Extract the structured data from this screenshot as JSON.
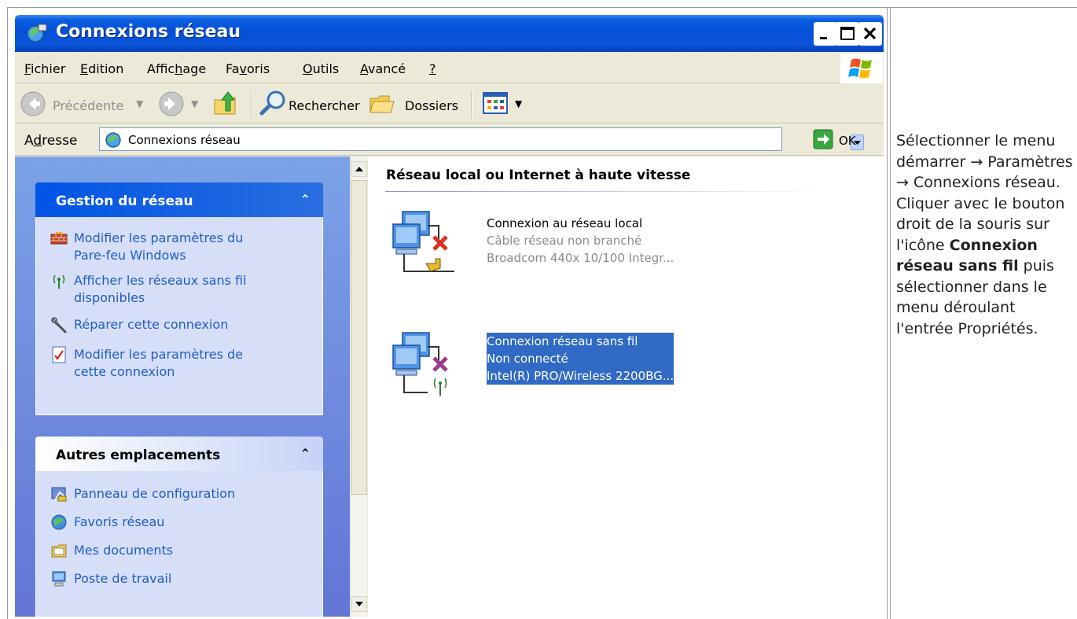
{
  "window": {
    "title": "Connexions réseau"
  },
  "menubar": {
    "items": [
      {
        "pre": "",
        "key": "F",
        "post": "ichier"
      },
      {
        "pre": "",
        "key": "E",
        "post": "dition"
      },
      {
        "pre": "Affic",
        "key": "h",
        "post": "age"
      },
      {
        "pre": "Fa",
        "key": "v",
        "post": "oris"
      },
      {
        "pre": "",
        "key": "O",
        "post": "utils"
      },
      {
        "pre": "",
        "key": "A",
        "post": "vancé"
      },
      {
        "pre": "",
        "key": "?",
        "post": ""
      }
    ]
  },
  "toolbar": {
    "back_label": "Précédente",
    "search_label": "Rechercher",
    "folders_label": "Dossiers"
  },
  "address": {
    "label_pre": "A",
    "label_key": "d",
    "label_post": "resse",
    "value": "Connexions réseau",
    "go_label": "OK"
  },
  "taskpane": {
    "network_tasks": {
      "title": "Gestion du réseau",
      "items": [
        {
          "line1": "Modifier les paramètres du",
          "line2": "Pare-feu Windows",
          "icon": "firewall-icon"
        },
        {
          "line1": "Afficher les réseaux sans fil",
          "line2": "disponibles",
          "icon": "wireless-icon"
        },
        {
          "line1": "Réparer cette connexion",
          "line2": "",
          "icon": "repair-icon"
        },
        {
          "line1": "Modifier les paramètres de",
          "line2": "cette connexion",
          "icon": "properties-icon"
        }
      ]
    },
    "other_places": {
      "title": "Autres emplacements",
      "items": [
        {
          "label": "Panneau de configuration",
          "icon": "control-panel-icon"
        },
        {
          "label": "Favoris réseau",
          "icon": "network-places-icon"
        },
        {
          "label": "Mes documents",
          "icon": "my-documents-icon"
        },
        {
          "label": "Poste de travail",
          "icon": "my-computer-icon"
        }
      ]
    }
  },
  "content": {
    "group_title": "Réseau local ou Internet à haute vitesse",
    "connections": [
      {
        "name": "Connexion au réseau local",
        "status": "Câble réseau non branché",
        "device": "Broadcom 440x 10/100 Integr...",
        "selected": false
      },
      {
        "name": "Connexion réseau sans fil",
        "status": "Non connecté",
        "device": "Intel(R) PRO/Wireless 2200BG...",
        "selected": true
      }
    ]
  },
  "instructions": {
    "part1": "Sélectionner le menu démarrer → Paramètres → Connexions réseau.",
    "part2": "Cliquer avec le bouton droit de la souris sur l'icône",
    "bold": "Connexion réseau sans fil",
    "part3": "puis sélectionner dans le menu déroulant l'entrée Propriétés."
  },
  "colors": {
    "titlebar": "#0550d8",
    "taskpane": "#7ba2e7",
    "selection": "#316ac5",
    "link": "#215dc6"
  }
}
